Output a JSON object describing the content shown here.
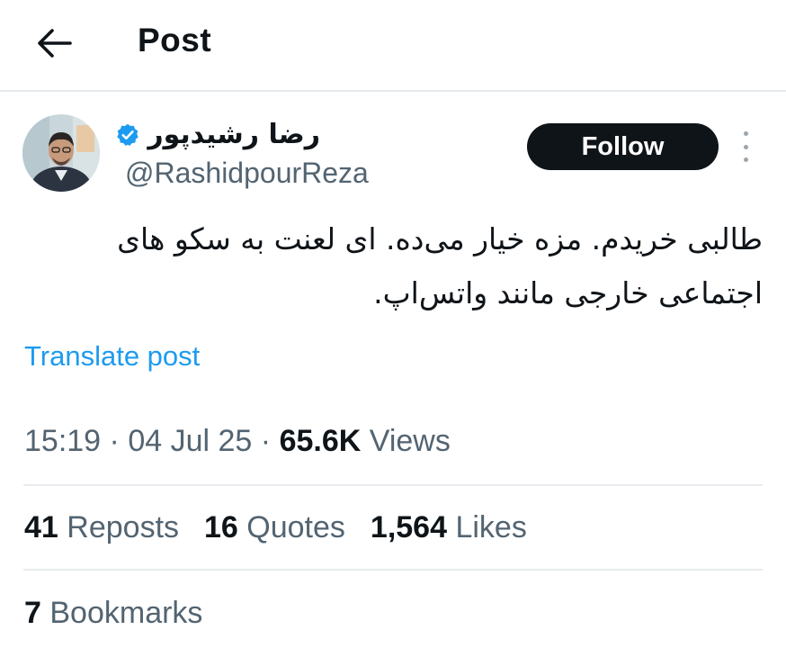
{
  "header": {
    "title": "Post",
    "back_icon": "arrow-left-icon"
  },
  "author": {
    "display_name": "رضا رشیدپور",
    "handle": "@RashidpourReza",
    "verified_color": "#1d9bf0"
  },
  "follow_label": "Follow",
  "post": {
    "line1": "طالبی خریدم. مزه خیار می‌ده. ای لعنت به سکو های",
    "line2": "اجتماعی خارجی مانند واتس‌اپ.",
    "translate_label": "Translate post"
  },
  "meta": {
    "time": "15:19",
    "sep1": "·",
    "date": "04 Jul 25",
    "sep2": "·",
    "views_count": "65.6K",
    "views_label": "Views"
  },
  "stats": {
    "reposts_count": "41",
    "reposts_label": "Reposts",
    "quotes_count": "16",
    "quotes_label": "Quotes",
    "likes_count": "1,564",
    "likes_label": "Likes",
    "bookmarks_count": "7",
    "bookmarks_label": "Bookmarks"
  }
}
